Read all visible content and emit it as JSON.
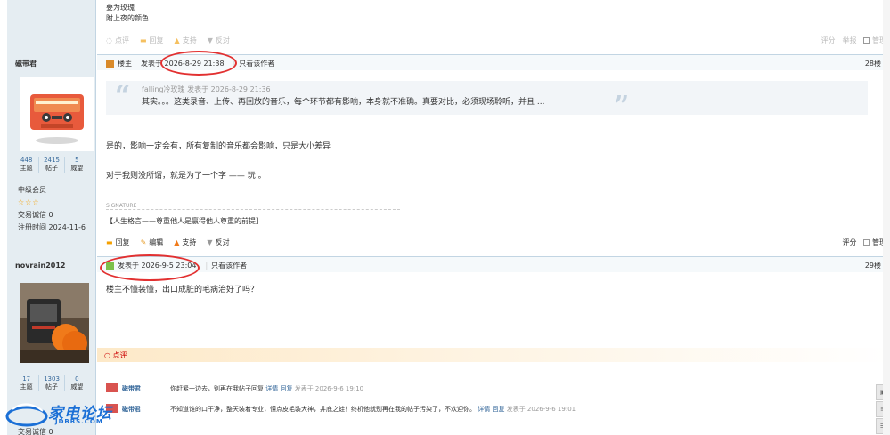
{
  "post_prev": {
    "lines": [
      "要为玫瑰",
      "附上夜的颜色"
    ],
    "actions": {
      "dianping": "点评",
      "reply": "回复",
      "support": "支持",
      "oppose": "反对"
    },
    "right": {
      "rate": "评分",
      "report": "举报",
      "manage": "管理"
    }
  },
  "post28": {
    "user": {
      "name": "磁带君",
      "stats": [
        {
          "value": "448",
          "label": "主题"
        },
        {
          "value": "2415",
          "label": "帖子"
        },
        {
          "value": "5",
          "label": "威望"
        }
      ],
      "level": "中级会员",
      "stars": "☆☆☆",
      "trust": "交易诚信 0",
      "reg": "注册时间  2024-11-6"
    },
    "header": {
      "owner": "楼主",
      "time": "发表于 2026-8-29 21:38",
      "sep": "|",
      "only_author": "只看该作者",
      "floor": "28楼"
    },
    "quote": {
      "meta": "falling冷玫瑰 发表于 2026-8-29 21:36",
      "text": "其实。。。这类录音、上传、再回放的音乐，每个环节都有影响，本身就不准确。真要对比，必须现场聆听，并且 ..."
    },
    "body": [
      "是的，影响一定会有，所有复制的音乐都会影响，只是大小差异",
      "对于我则没所谓，就是为了一个字 —— 玩 。"
    ],
    "signature_label": "SIGNATURE",
    "signature": "【人生格言——尊重他人是赢得他人尊重的前提】",
    "actions": {
      "reply": "回复",
      "edit": "编辑",
      "support": "支持",
      "oppose": "反对"
    },
    "right": {
      "rate": "评分",
      "manage": "管理"
    }
  },
  "post29": {
    "user": {
      "name": "novrain2012",
      "stats": [
        {
          "value": "17",
          "label": "主题"
        },
        {
          "value": "1303",
          "label": "帖子"
        },
        {
          "value": "0",
          "label": "威望"
        }
      ],
      "trust": "交易诚信 0"
    },
    "header": {
      "time": "发表于 2026-9-5 23:04",
      "sep": "|",
      "only_author": "只看该作者",
      "floor": "29楼"
    },
    "body": "楼主不懂装懂，出口成脏的毛病治好了吗？",
    "dianping": "点评",
    "comments": [
      {
        "name": "磁带君",
        "text": "你赶紧一边去，别再在我帖子回复",
        "detail": "详情",
        "reply": "回复",
        "time": "发表于 2026-9-6 19:10"
      },
      {
        "name": "磁带君",
        "text": "不知道谁的口干净，整天装着专业，懂点皮毛装大神，井底之蛙！终机他就别再在我的帖子污染了，不欢迎你。",
        "detail": "详情",
        "reply": "回复",
        "time": "发表于 2026-9-6 19:01"
      }
    ]
  },
  "watermark": {
    "brand": "家电论坛",
    "sub": "JDBBS.COM"
  },
  "colors": {
    "accent": "#e23030",
    "link": "#336699",
    "panel": "#e5edf2"
  }
}
